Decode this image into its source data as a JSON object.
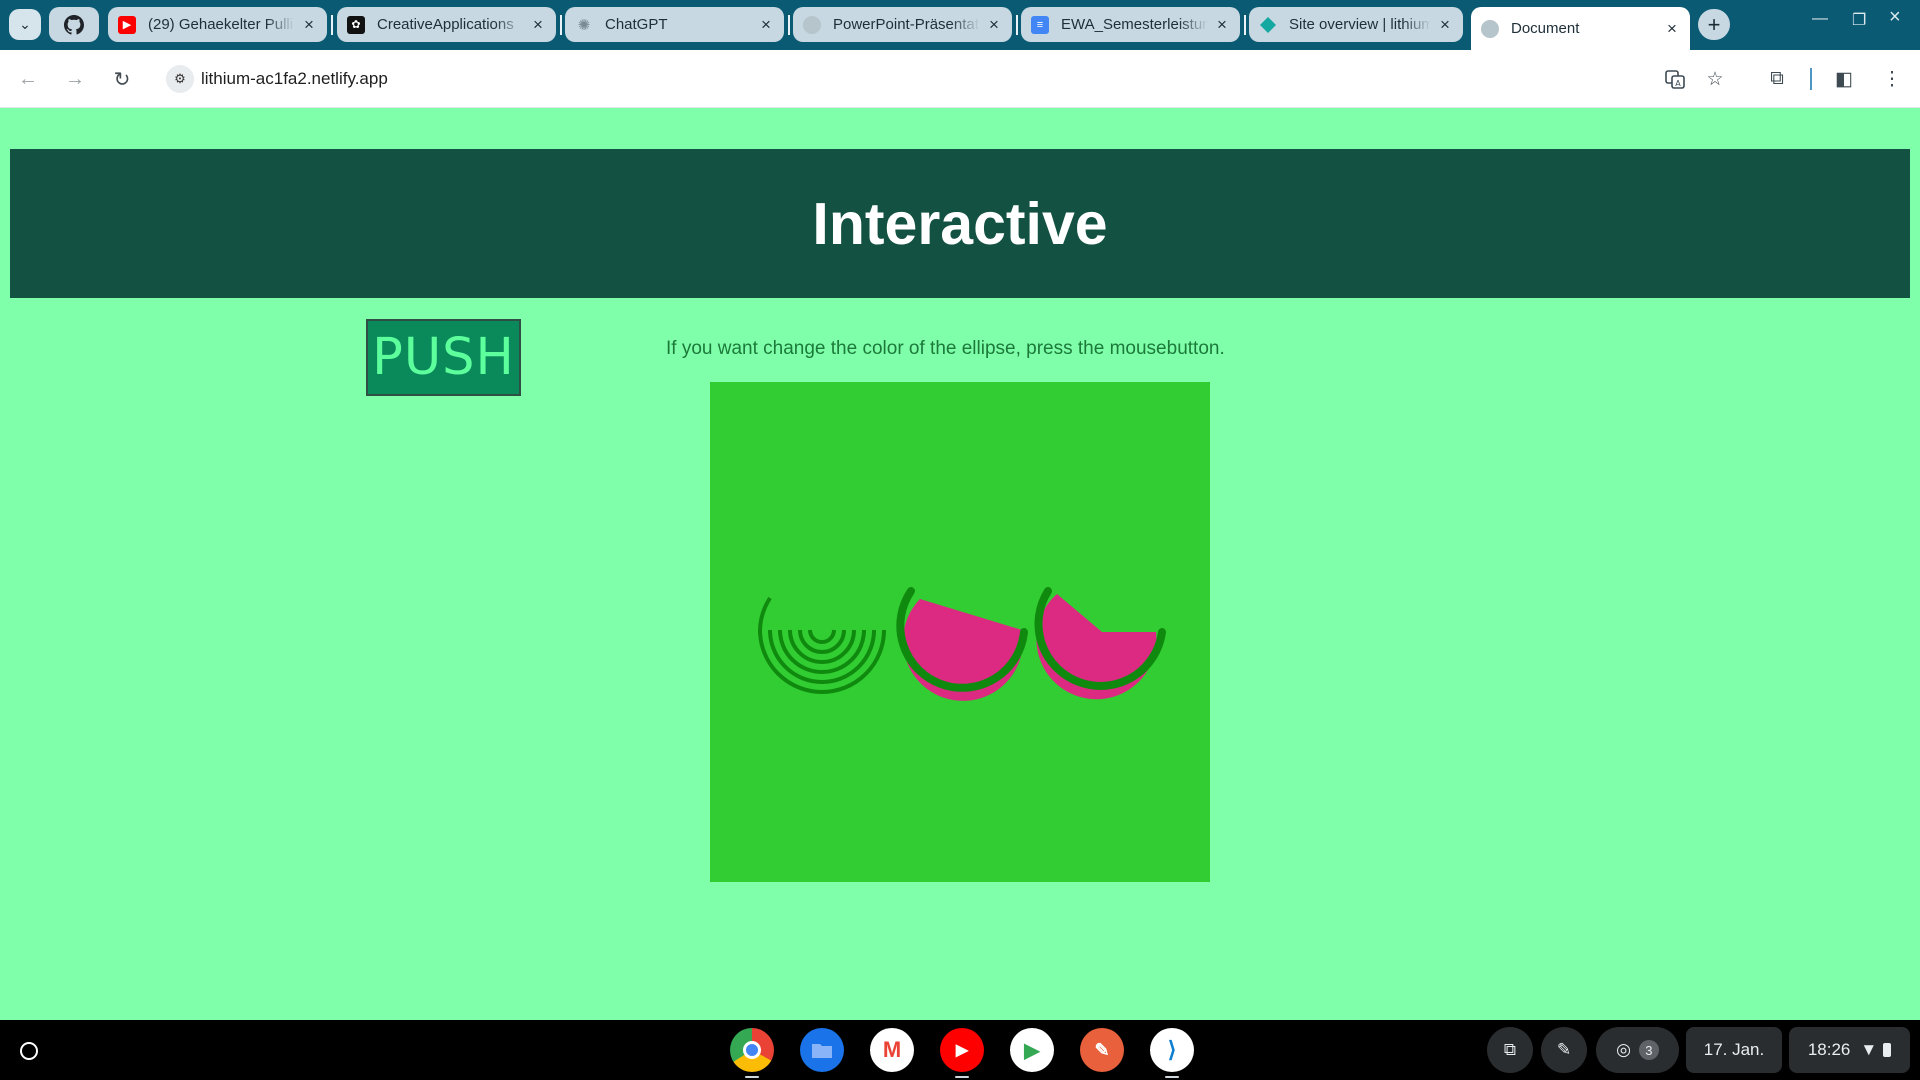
{
  "browser": {
    "tabs": [
      {
        "title": "(29) Gehaekelter Pulli",
        "icon": "youtube-icon",
        "color": "#ff0000"
      },
      {
        "title": "CreativeApplications",
        "icon": "creativeapplications-icon",
        "color": "#111111"
      },
      {
        "title": "ChatGPT",
        "icon": "chatgpt-icon",
        "color": "#9aa8b0"
      },
      {
        "title": "PowerPoint-Präsentation",
        "icon": "globe-icon",
        "color": "#9aa8b0"
      },
      {
        "title": "EWA_Semesterleistung",
        "icon": "google-docs-icon",
        "color": "#4285f4"
      },
      {
        "title": "Site overview | lithium",
        "icon": "netlify-icon",
        "color": "#14a8a0"
      },
      {
        "title": "Document",
        "icon": "globe-icon",
        "color": "#9aa8b0",
        "active": true
      }
    ],
    "url": "lithium-ac1fa2.netlify.app"
  },
  "page": {
    "heading": "Interactive",
    "push_label": "PUSH",
    "instruction": "If you want change the color of the ellipse, press the mousebutton.",
    "canvas_background": "#32cd32",
    "shape_fill": "#dc2a82",
    "shape_stroke": "#0f8a0f"
  },
  "shelf": {
    "apps": [
      "chrome-icon",
      "files-icon",
      "gmail-icon",
      "youtube-icon",
      "play-store-icon",
      "sketch-app-icon",
      "vscode-icon"
    ],
    "tray": {
      "notifications": "3",
      "date": "17. Jan.",
      "time": "18:26"
    }
  }
}
